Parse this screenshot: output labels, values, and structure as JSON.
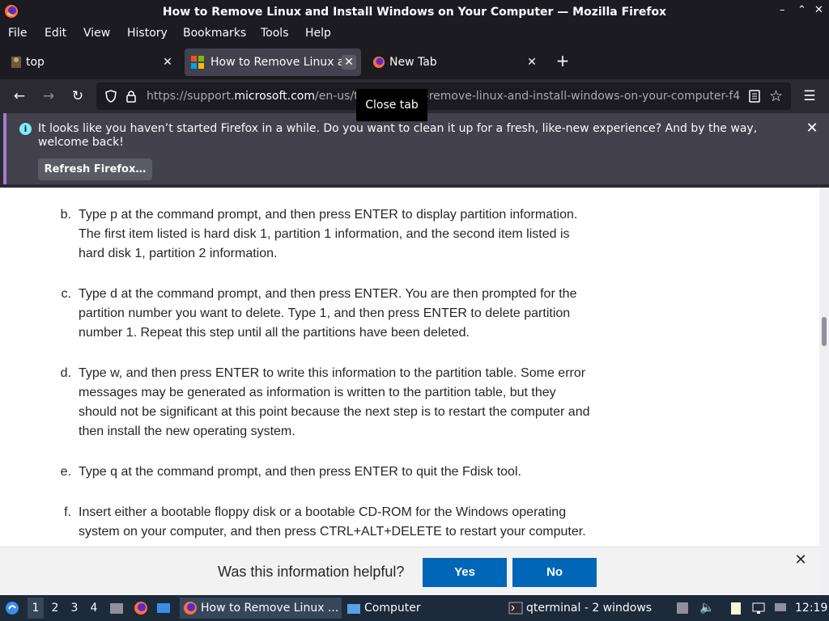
{
  "window": {
    "title": "How to Remove Linux and Install Windows on Your Computer — Mozilla Firefox",
    "controls": [
      "–",
      "⌃",
      "✕"
    ]
  },
  "menu": [
    "File",
    "Edit",
    "View",
    "History",
    "Bookmarks",
    "Tools",
    "Help"
  ],
  "tabs": [
    {
      "label": "top",
      "icon": "terminal-figure-icon",
      "active": false
    },
    {
      "label": "How to Remove Linux an",
      "icon": "microsoft-logo-icon",
      "active": true
    },
    {
      "label": "New Tab",
      "icon": "firefox-icon",
      "active": false
    }
  ],
  "toolbar": {
    "url_prefix": "https://support.",
    "url_domain": "microsoft.com",
    "url_rest": "/en-us/topic/how-to-remove-linux-and-install-windows-on-your-computer-f4",
    "tooltip": "Close tab"
  },
  "notification": {
    "message": "It looks like you haven’t started Firefox in a while. Do you want to clean it up for a fresh, like-new experience? And by the way, welcome back!",
    "refresh_label": "Refresh Firefox…"
  },
  "article": {
    "items": [
      {
        "marker": "b.",
        "text": "Type p at the command prompt, and then press ENTER to display partition information. The first item listed is hard disk 1, partition 1 information, and the second item listed is hard disk 1, partition 2 information."
      },
      {
        "marker": "c.",
        "text": "Type d at the command prompt, and then press ENTER. You are then prompted for the partition number you want to delete. Type 1, and then press ENTER to delete partition number 1. Repeat this step until all the partitions have been deleted."
      },
      {
        "marker": "d.",
        "text": "Type w, and then press ENTER to write this information to the partition table. Some error messages may be generated as information is written to the partition table, but they should not be significant at this point because the next step is to restart the computer and then install the new operating system."
      },
      {
        "marker": "e.",
        "text": "Type q at the command prompt, and then press ENTER to quit the Fdisk tool."
      },
      {
        "marker": "f.",
        "text": "Insert either a bootable floppy disk or a bootable CD-ROM for the Windows operating system on your computer, and then press CTRL+ALT+DELETE to restart your computer."
      }
    ]
  },
  "feedback": {
    "question": "Was this information helpful?",
    "yes": "Yes",
    "no": "No"
  },
  "taskbar": {
    "workspaces": [
      "1",
      "2",
      "3",
      "4"
    ],
    "tasks": [
      {
        "label": "How to Remove Linux ...",
        "icon": "firefox-icon"
      },
      {
        "label": "Computer",
        "icon": "folder-icon"
      },
      {
        "label": "qterminal - 2 windows",
        "icon": "terminal-icon"
      }
    ],
    "clock": "12:19"
  },
  "colors": {
    "accent_blue": "#0067b8",
    "chrome_dark": "#1c1b22",
    "notification_bg": "#42414d"
  }
}
